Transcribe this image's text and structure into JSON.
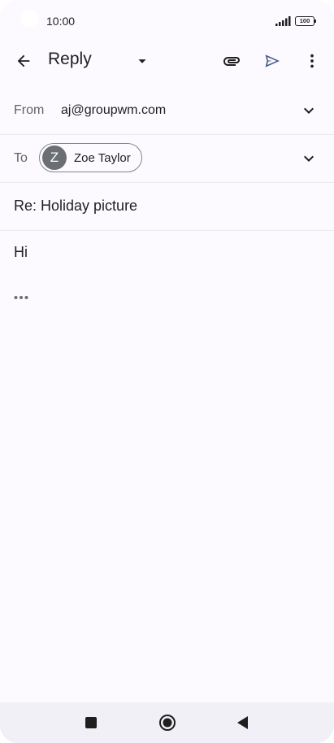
{
  "status_bar": {
    "time": "10:00",
    "battery": "100"
  },
  "toolbar": {
    "title": "Reply",
    "icons": [
      "back-arrow-icon",
      "dropdown-arrow-icon",
      "attachment-icon",
      "send-icon",
      "more-vert-icon"
    ]
  },
  "compose": {
    "from_label": "From",
    "from_value": "aj@groupwm.com",
    "to_label": "To",
    "recipient": {
      "initial": "Z",
      "name": "Zoe Taylor"
    },
    "subject": "Re: Holiday picture",
    "body": "Hi"
  },
  "nav_bar": {
    "icons": [
      "recents-square-icon",
      "home-circle-icon",
      "back-triangle-icon"
    ]
  },
  "colors": {
    "background": "#fcfaff",
    "send_accent": "#4a5d8c",
    "chip_avatar": "#6b6e73",
    "nav_bar": "#f2f0f7"
  }
}
